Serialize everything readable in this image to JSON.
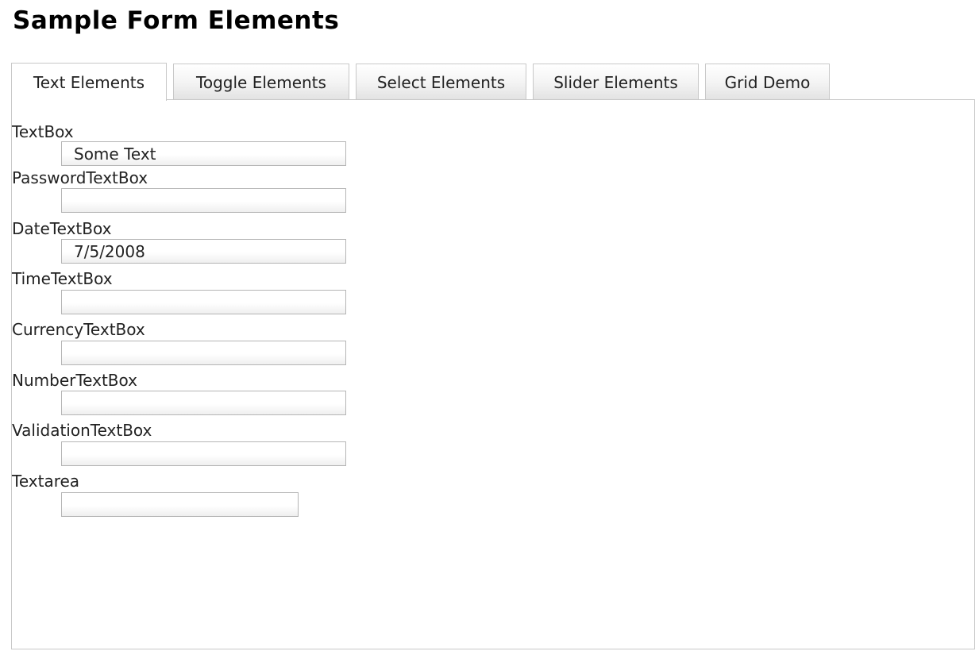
{
  "page": {
    "title": "Sample Form Elements"
  },
  "tabs": [
    {
      "label": "Text Elements",
      "active": true
    },
    {
      "label": "Toggle Elements",
      "active": false
    },
    {
      "label": "Select Elements",
      "active": false
    },
    {
      "label": "Slider Elements",
      "active": false
    },
    {
      "label": "Grid Demo",
      "active": false
    }
  ],
  "form": {
    "textbox": {
      "label": "TextBox",
      "value": "Some Text"
    },
    "password": {
      "label": "PasswordTextBox",
      "value": ""
    },
    "date": {
      "label": "DateTextBox",
      "value": "7/5/2008"
    },
    "time": {
      "label": "TimeTextBox",
      "value": ""
    },
    "currency": {
      "label": "CurrencyTextBox",
      "value": ""
    },
    "number": {
      "label": "NumberTextBox",
      "value": ""
    },
    "validation": {
      "label": "ValidationTextBox",
      "value": ""
    },
    "textarea": {
      "label": "Textarea",
      "value": ""
    }
  },
  "colors": {
    "border": "#c8c8c8",
    "input_border": "#b5b5b5",
    "text": "#222222",
    "title": "#000000"
  }
}
